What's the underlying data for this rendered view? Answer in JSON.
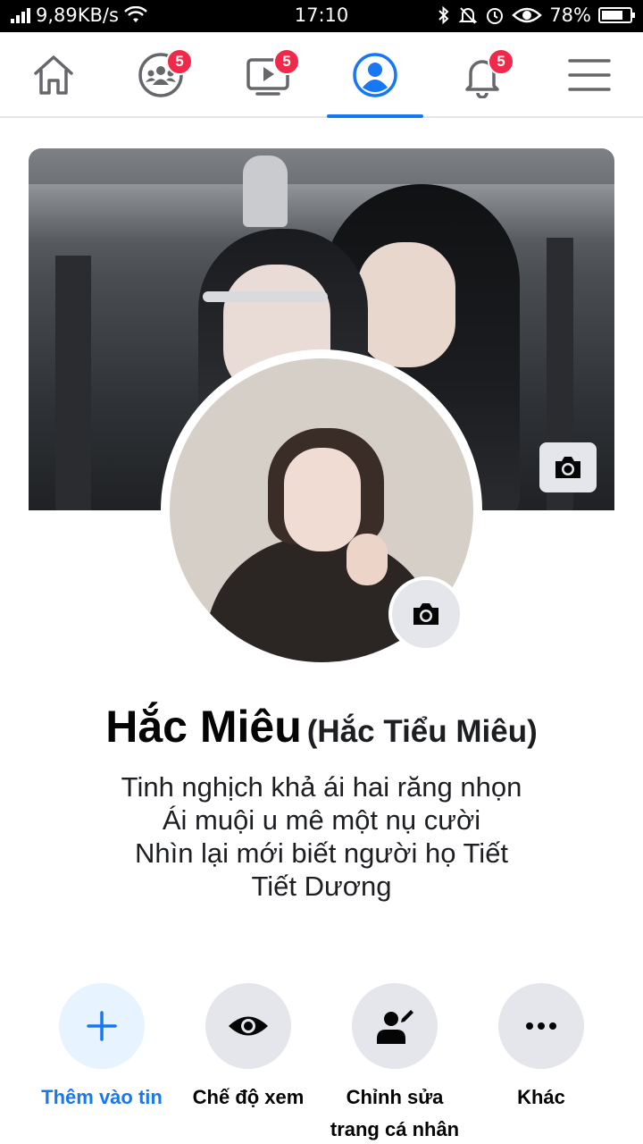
{
  "status_bar": {
    "speed": "9,89KB/s",
    "time": "17:10",
    "battery": "78%",
    "battery_level": 0.78,
    "icons": [
      "signal-icon",
      "wifi-icon",
      "bluetooth-icon",
      "mute-icon",
      "alarm-icon",
      "eye-icon",
      "battery-icon"
    ]
  },
  "nav": {
    "items": [
      {
        "name": "home",
        "icon": "home-icon",
        "badge": ""
      },
      {
        "name": "groups",
        "icon": "groups-icon",
        "badge": "5"
      },
      {
        "name": "watch",
        "icon": "video-icon",
        "badge": "5"
      },
      {
        "name": "profile",
        "icon": "profile-icon",
        "badge": "",
        "active": true
      },
      {
        "name": "notifications",
        "icon": "bell-icon",
        "badge": "5"
      },
      {
        "name": "menu",
        "icon": "menu-icon",
        "badge": ""
      }
    ],
    "accent": "#1877f2",
    "badge_color": "#f02849"
  },
  "profile": {
    "name": "Hắc Miêu",
    "alternate_name": "(Hắc Tiểu Miêu)",
    "bio": [
      "Tinh nghịch khả ái hai răng nhọn",
      "Ái muội u mê một nụ cười",
      "Nhìn lại mới biết người họ Tiết",
      "Tiết Dương"
    ]
  },
  "actions": [
    {
      "label": "Thêm vào tin",
      "icon": "plus-icon"
    },
    {
      "label": "Chế độ xem",
      "icon": "eye-icon"
    },
    {
      "label_line1": "Chỉnh sửa",
      "label_line2": "trang cá nhân",
      "icon": "edit-profile-icon"
    },
    {
      "label": "Khác",
      "icon": "more-icon"
    }
  ]
}
